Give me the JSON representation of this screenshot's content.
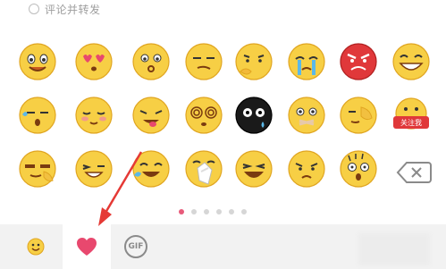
{
  "composer": {
    "comment_and_repost_label": "评论并转发"
  },
  "emoji_panel": {
    "emojis": [
      {
        "name": "smile-emoji"
      },
      {
        "name": "heart-eyes-emoji"
      },
      {
        "name": "whistle-emoji"
      },
      {
        "name": "smirk-emoji"
      },
      {
        "name": "thinking-emoji"
      },
      {
        "name": "crying-emoji"
      },
      {
        "name": "angry-emoji"
      },
      {
        "name": "grin-emoji"
      },
      {
        "name": "sleepy-emoji"
      },
      {
        "name": "shy-emoji"
      },
      {
        "name": "tongue-emoji"
      },
      {
        "name": "dizzy-emoji"
      },
      {
        "name": "black-face-emoji"
      },
      {
        "name": "silent-emoji"
      },
      {
        "name": "facepalm-emoji"
      },
      {
        "name": "follow-me-emoji"
      },
      {
        "name": "cool-emoji"
      },
      {
        "name": "wink-emoji"
      },
      {
        "name": "laugh-tears-emoji"
      },
      {
        "name": "clap-emoji"
      },
      {
        "name": "lol-emoji"
      },
      {
        "name": "sad-emoji"
      },
      {
        "name": "scared-emoji"
      }
    ],
    "follow_me_text": "关注我",
    "pager": {
      "count": 6,
      "active_index": 0
    }
  },
  "bottom_bar": {
    "gif_label": "GIF"
  },
  "colors": {
    "emoji_face": "#f7cf45",
    "emoji_outline": "#e0a520",
    "heart": "#e8486e",
    "arrow": "#e53935",
    "pager_active": "#e85a7a",
    "pager_inactive": "#d6d6d6"
  }
}
